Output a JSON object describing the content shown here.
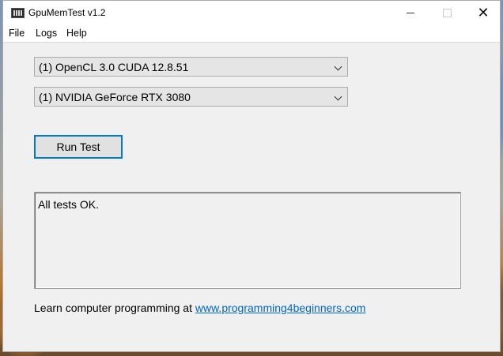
{
  "window": {
    "title": "GpuMemTest v1.2",
    "icons": {
      "app": "gpu-card-icon",
      "minimize": "minimize-icon",
      "maximize": "maximize-icon",
      "close": "close-icon"
    },
    "close_glyph": "✕"
  },
  "menu": {
    "items": [
      "File",
      "Logs",
      "Help"
    ]
  },
  "controls": {
    "platform_select": {
      "selected": "(1) OpenCL 3.0 CUDA 12.8.51",
      "icon": "chevron-down-icon"
    },
    "device_select": {
      "selected": "(1) NVIDIA GeForce RTX 3080",
      "icon": "chevron-down-icon"
    },
    "run_button_label": "Run Test"
  },
  "output": {
    "text": "All tests OK."
  },
  "footer": {
    "text": "Learn computer programming at ",
    "link_text": "www.programming4beginners.com"
  },
  "colors": {
    "accent": "#0078d7",
    "link": "#0066cc",
    "window_bg": "#f0f0f0"
  }
}
